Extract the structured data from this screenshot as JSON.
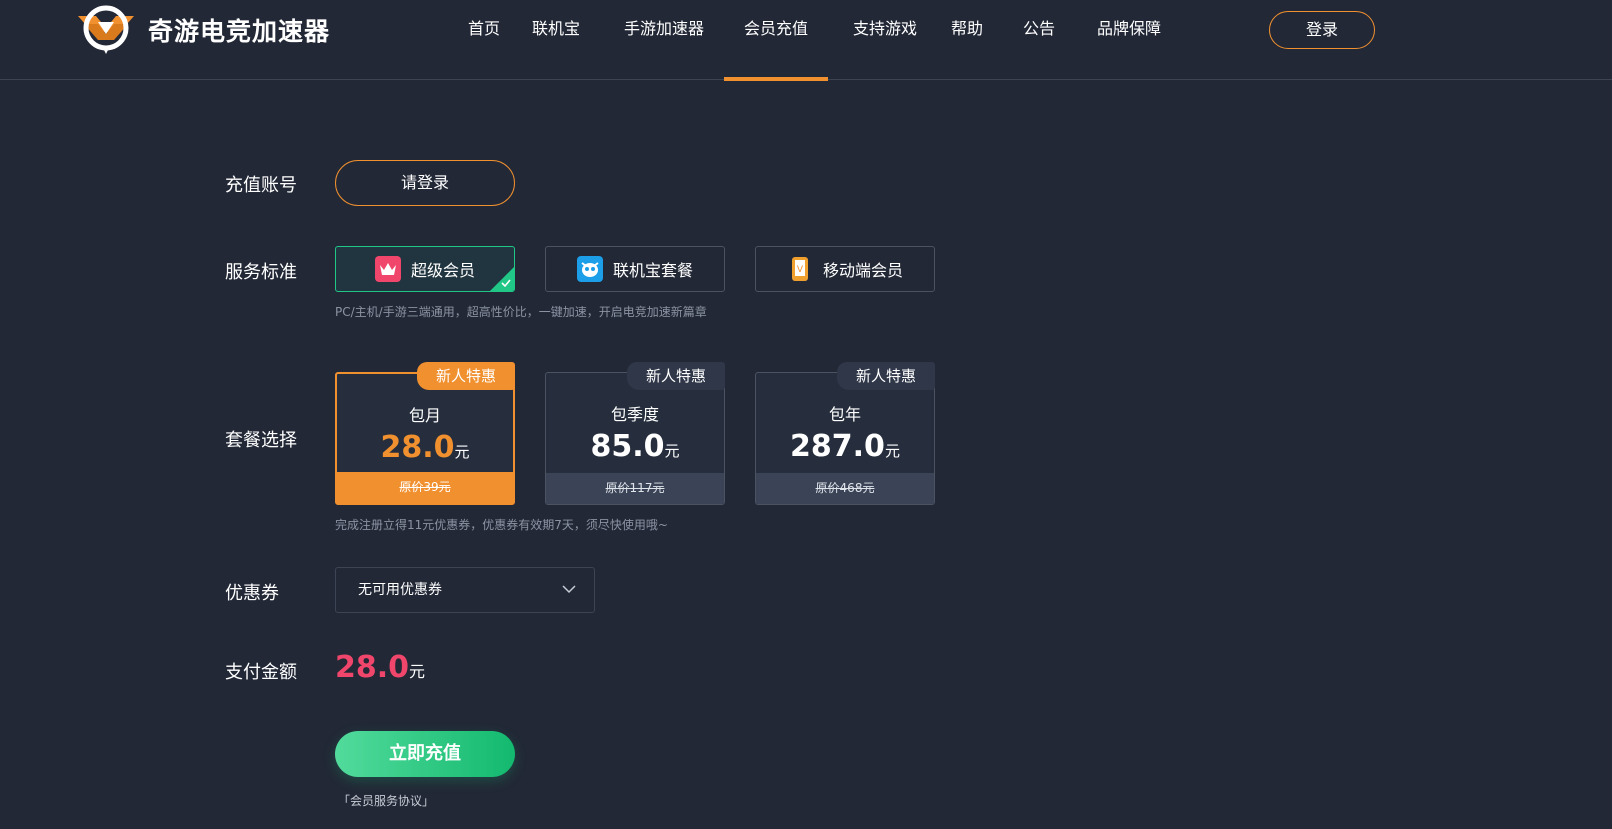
{
  "header": {
    "logo_text": "奇游电竞加速器",
    "nav": [
      {
        "label": "首页"
      },
      {
        "label": "联机宝"
      },
      {
        "label": "手游加速器"
      },
      {
        "label": "会员充值"
      },
      {
        "label": "支持游戏"
      },
      {
        "label": "帮助"
      },
      {
        "label": "公告"
      },
      {
        "label": "品牌保障"
      }
    ],
    "active_nav": "会员充值",
    "login_label": "登录"
  },
  "form": {
    "account": {
      "label": "充值账号",
      "button": "请登录"
    },
    "service": {
      "label": "服务标准",
      "options": [
        {
          "label": "超级会员",
          "icon": "crown-icon",
          "selected": true
        },
        {
          "label": "联机宝套餐",
          "icon": "mascot-icon",
          "selected": false
        },
        {
          "label": "移动端会员",
          "icon": "phone-icon",
          "selected": false
        }
      ],
      "hint": "PC/主机/手游三端通用，超高性价比，一键加速，开启电竞加速新篇章"
    },
    "plans": {
      "label": "套餐选择",
      "items": [
        {
          "badge": "新人特惠",
          "name": "包月",
          "price": "28.0",
          "unit": "元",
          "original": "原价39元",
          "selected": true
        },
        {
          "badge": "新人特惠",
          "name": "包季度",
          "price": "85.0",
          "unit": "元",
          "original": "原价117元",
          "selected": false
        },
        {
          "badge": "新人特惠",
          "name": "包年",
          "price": "287.0",
          "unit": "元",
          "original": "原价468元",
          "selected": false
        }
      ],
      "hint": "完成注册立得11元优惠券，优惠券有效期7天，须尽快使用哦~"
    },
    "coupon": {
      "label": "优惠券",
      "value": "无可用优惠券"
    },
    "payment": {
      "label": "支付金额",
      "amount": "28.0",
      "unit": "元"
    },
    "submit_label": "立即充值",
    "agreement": "「会员服务协议」"
  },
  "colors": {
    "background": "#222836",
    "accent_orange": "#f0902f",
    "accent_green": "#20c787",
    "price_red": "#f0466b"
  }
}
